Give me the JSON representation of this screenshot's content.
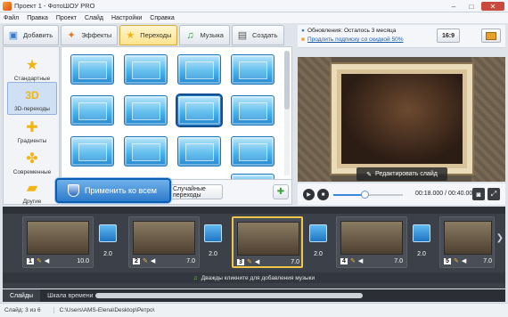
{
  "window": {
    "title": "Проект 1 - ФотоШОУ PRO",
    "minimize": "–",
    "maximize": "□",
    "close": "✕"
  },
  "menu": [
    "Файл",
    "Правка",
    "Проект",
    "Слайд",
    "Настройки",
    "Справка"
  ],
  "tabs": [
    {
      "label": "Добавить",
      "icon": "folder-icon"
    },
    {
      "label": "Эффекты",
      "icon": "effects-icon"
    },
    {
      "label": "Переходы",
      "icon": "star-icon",
      "active": true
    },
    {
      "label": "Музыка",
      "icon": "music-icon"
    },
    {
      "label": "Создать",
      "icon": "create-icon"
    }
  ],
  "categories": [
    {
      "label": "Стандартные",
      "icon": "star-icon"
    },
    {
      "label": "3D-переходы",
      "icon": "3d-icon",
      "active": true
    },
    {
      "label": "Градиенты",
      "icon": "gradient-icon"
    },
    {
      "label": "Современные",
      "icon": "puzzle-icon"
    },
    {
      "label": "Другие",
      "icon": "folder-icon"
    }
  ],
  "apply_all_label": "Применить ко всем",
  "random_label": "Случайные переходы",
  "info": {
    "updates": "Обновления: Осталось 3 месяца",
    "extend_link": "Продлить подписку со скидкой 50%"
  },
  "ratio_label": "16:9",
  "edit_slide_label": "Редактировать слайд",
  "player": {
    "time": "00:18.000 / 00:40.000",
    "progress": 0.45
  },
  "slides": [
    {
      "num": "1",
      "duration": "10.0"
    },
    {
      "num": "2",
      "duration": "7.0"
    },
    {
      "num": "3",
      "duration": "7.0",
      "selected": true
    },
    {
      "num": "4",
      "duration": "7.0"
    },
    {
      "num": "5",
      "duration": "7.0"
    }
  ],
  "transitions": [
    "2.0",
    "2.0",
    "2.0",
    "2.0",
    "2.0"
  ],
  "music_hint": "Дважды кликните для добавления музыки",
  "bottom_tabs": [
    "Слайды",
    "Шкала времени"
  ],
  "status": {
    "slide": "Слайд: 3 из 6",
    "path": "C:\\Users\\AMS-Elena\\Desktop\\Ретро\\"
  },
  "colors": {
    "accent": "#2e7bcc",
    "selection": "#f0c64a",
    "timeline": "#3c4048"
  }
}
